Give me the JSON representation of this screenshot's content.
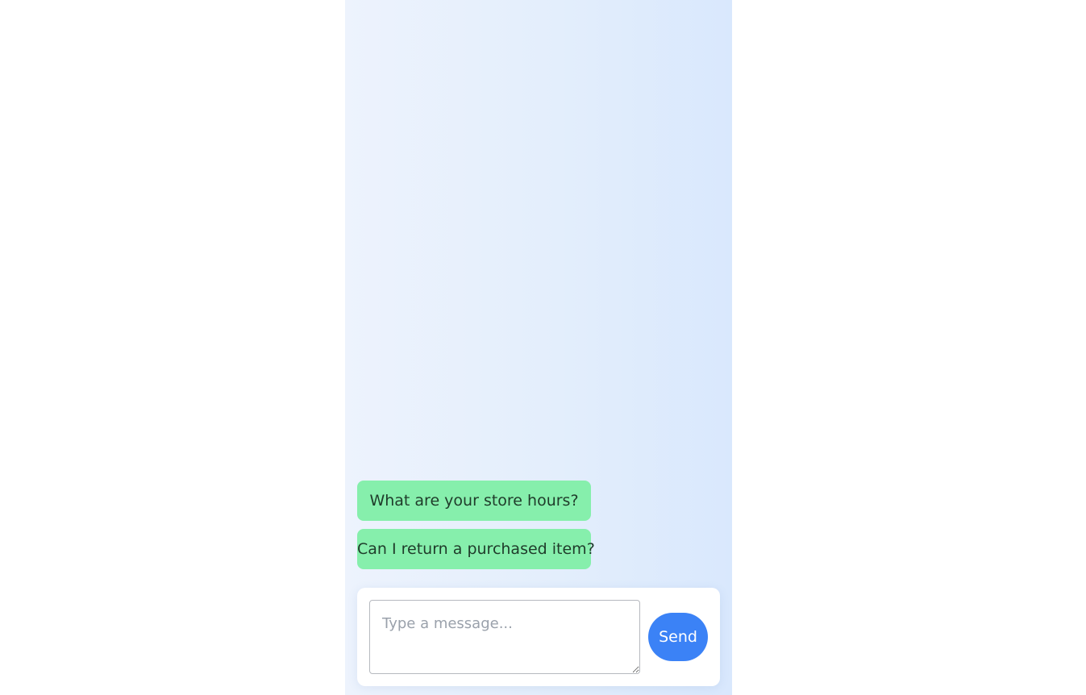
{
  "chat": {
    "suggestions": [
      {
        "label": "What are your store hours?"
      },
      {
        "label": "Can I return a purchased item?"
      }
    ]
  },
  "composer": {
    "placeholder": "Type a message...",
    "value": "",
    "send_label": "Send"
  },
  "colors": {
    "suggestion_bg": "#86efac",
    "send_bg": "#3b82f6",
    "panel_gradient_start": "#edf3fd",
    "panel_gradient_end": "#d9e8fd"
  }
}
